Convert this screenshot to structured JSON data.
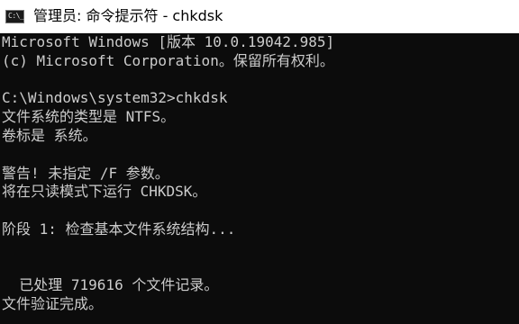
{
  "window": {
    "icon_text": "C:\\_",
    "title": "管理员: 命令提示符 - chkdsk"
  },
  "console": {
    "lines": [
      "Microsoft Windows [版本 10.0.19042.985]",
      "(c) Microsoft Corporation。保留所有权利。",
      "",
      "C:\\Windows\\system32>chkdsk",
      "文件系统的类型是 NTFS。",
      "卷标是 系统。",
      "",
      "警告! 未指定 /F 参数。",
      "将在只读模式下运行 CHKDSK。",
      "",
      "阶段 1: 检查基本文件系统结构...",
      "",
      "",
      "  已处理 719616 个文件记录。",
      "文件验证完成。"
    ]
  }
}
